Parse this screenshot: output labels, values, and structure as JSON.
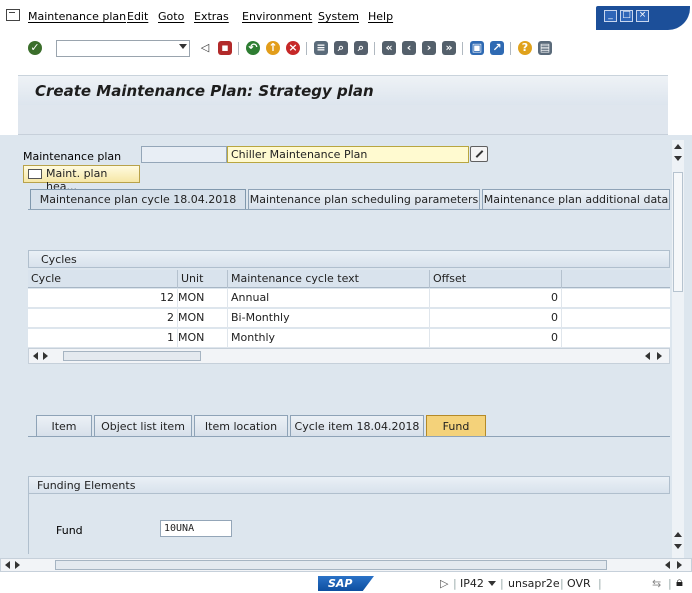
{
  "menu": {
    "items": [
      "Maintenance plan",
      "Edit",
      "Goto",
      "Extras",
      "Environment",
      "System",
      "Help"
    ]
  },
  "toolbar": {
    "icons": [
      "enter-icon",
      "back-icon",
      "save-icon",
      "back-nav-icon",
      "exit-icon",
      "cancel-icon",
      "print-icon",
      "find-icon",
      "find-next-icon",
      "first-page-icon",
      "prev-page-icon",
      "next-page-icon",
      "last-page-icon",
      "new-session-icon",
      "shortcut-icon",
      "help-icon",
      "layout-icon"
    ]
  },
  "screen": {
    "title": "Create Maintenance Plan: Strategy plan"
  },
  "header": {
    "plan_label": "Maintenance plan",
    "plan_value": "",
    "plan_description": "Chiller Maintenance Plan",
    "header_button": "Maint. plan hea..."
  },
  "tabs": {
    "top": [
      "Maintenance plan cycle 18.04.2018",
      "Maintenance plan scheduling parameters",
      "Maintenance plan additional data"
    ],
    "active_top": 0,
    "bottom": [
      "Item",
      "Object list item",
      "Item location",
      "Cycle item 18.04.2018",
      "Fund"
    ],
    "active_bottom": 4
  },
  "cycles": {
    "title": "Cycles",
    "columns": [
      "Cycle",
      "Unit",
      "Maintenance cycle text",
      "Offset"
    ],
    "rows": [
      {
        "cycle": "12",
        "unit": "MON",
        "text": "Annual",
        "offset": "0"
      },
      {
        "cycle": "2",
        "unit": "MON",
        "text": "Bi-Monthly",
        "offset": "0"
      },
      {
        "cycle": "1",
        "unit": "MON",
        "text": "Monthly",
        "offset": "0"
      }
    ]
  },
  "funding": {
    "title": "Funding Elements",
    "fund_label": "Fund",
    "fund_value": "10UNA"
  },
  "status": {
    "logo": "SAP",
    "system": "IP42",
    "client": "unsapr2e",
    "mode": "OVR"
  },
  "colors": {
    "title_bar": "#dfe6ee",
    "window_controls": "#1c4f99",
    "active_tab": "#f4d27a",
    "field_highlight": "#fffad0"
  }
}
